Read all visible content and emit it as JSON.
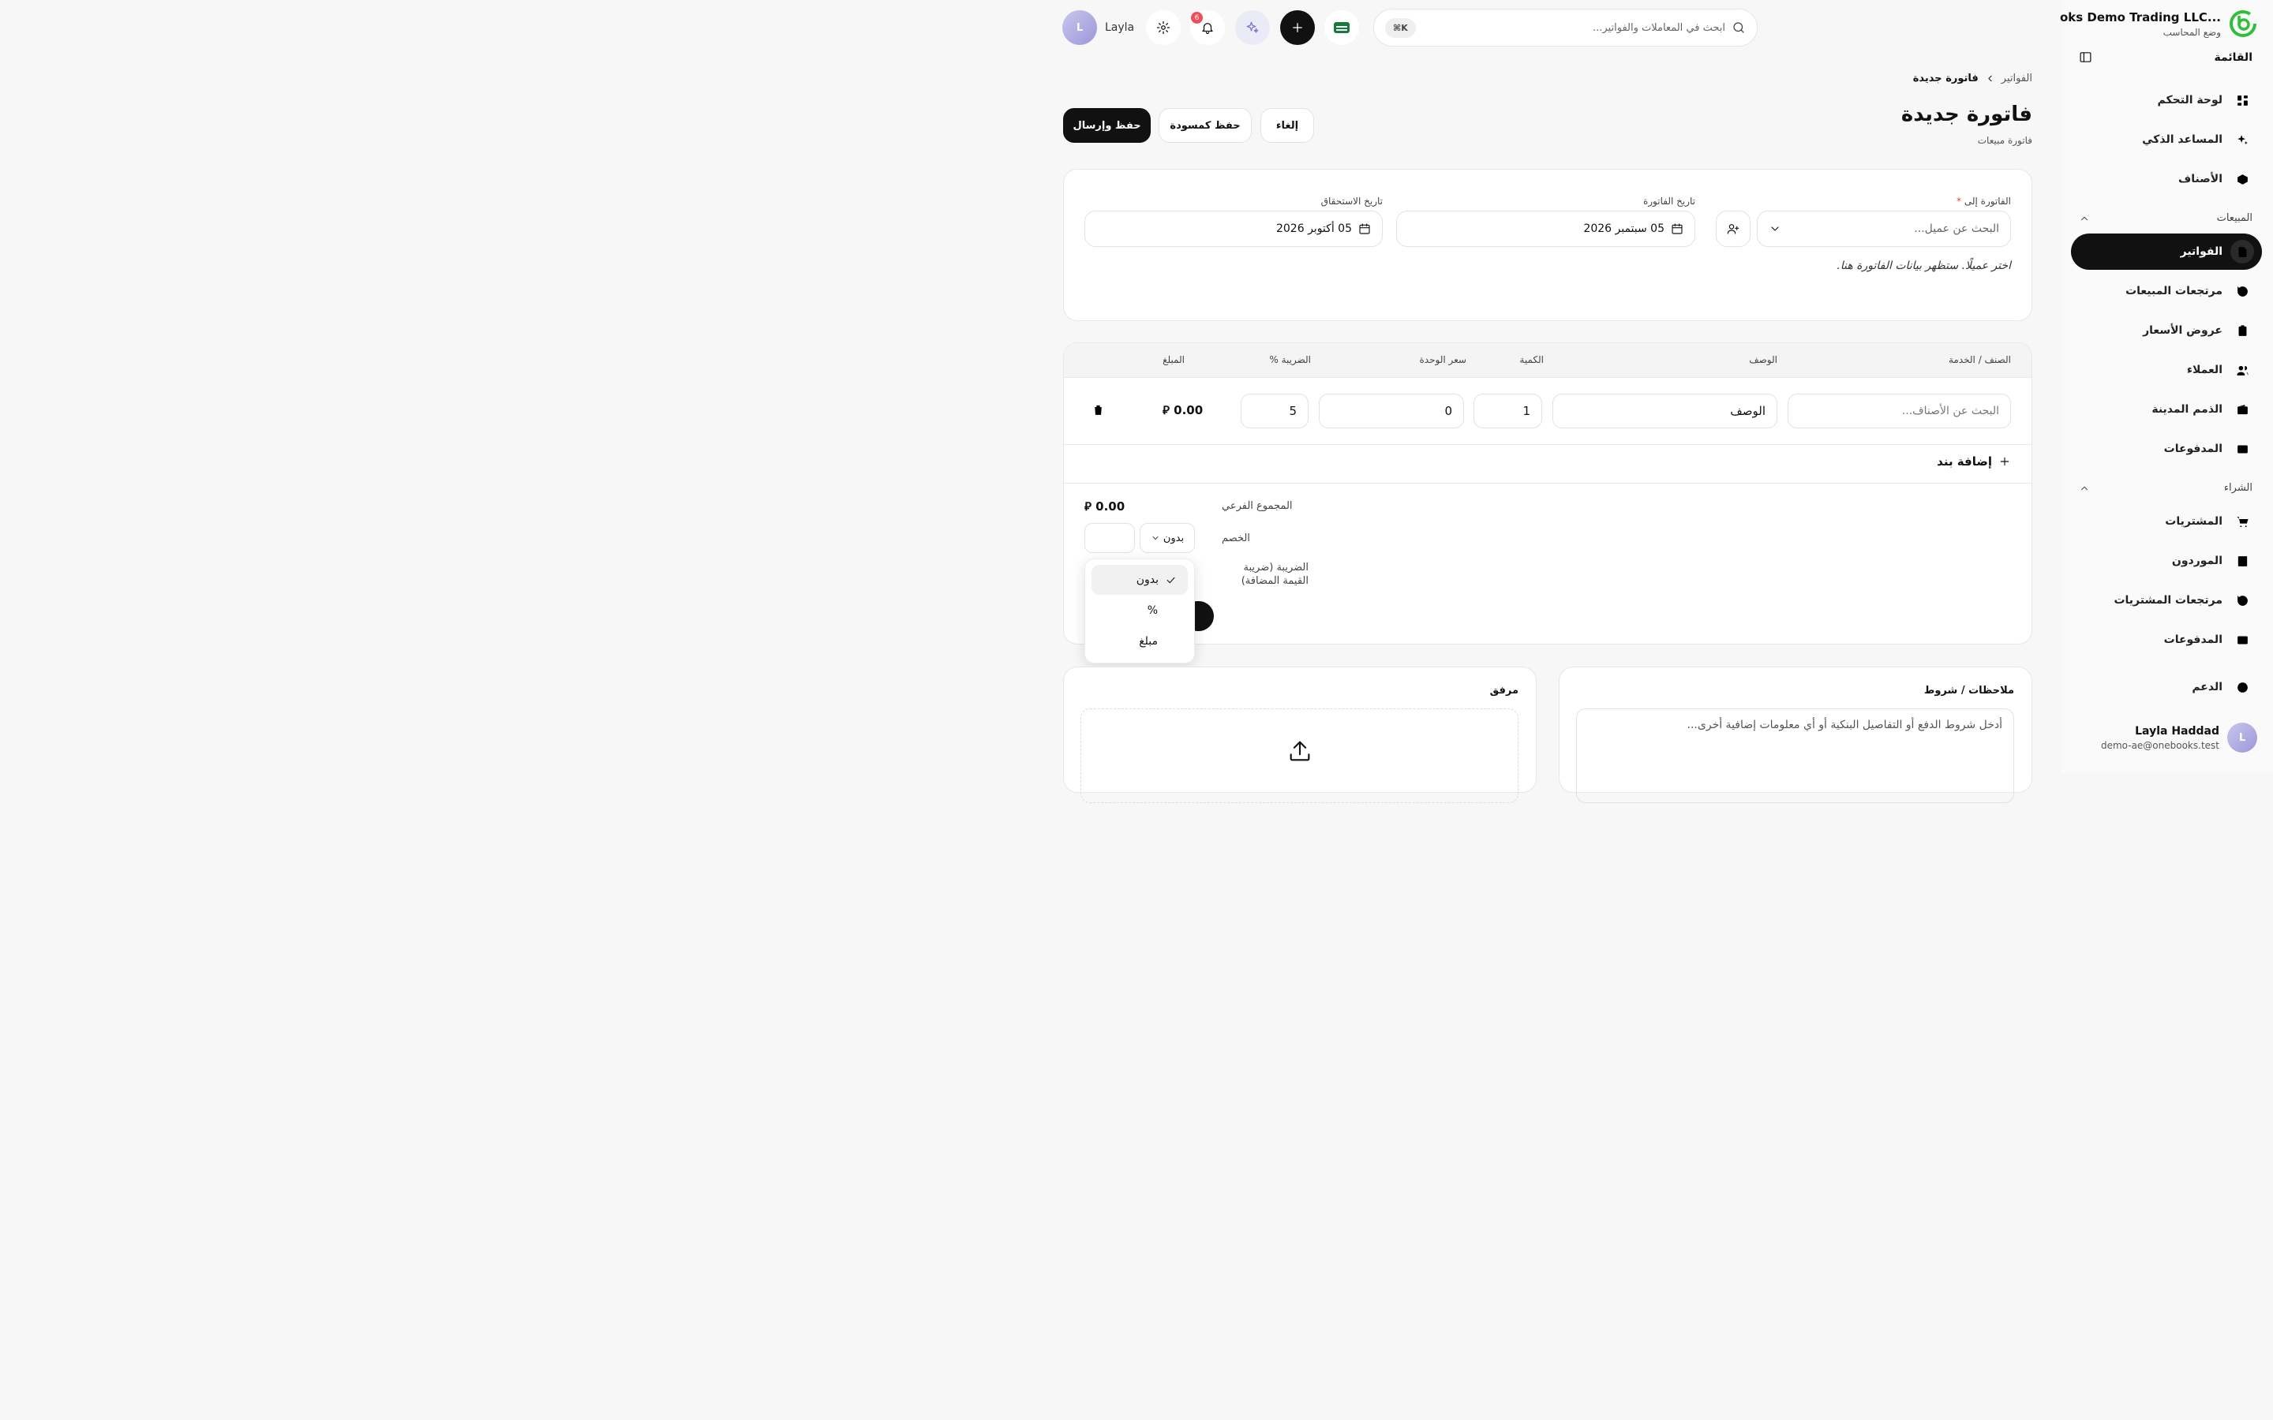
{
  "sidebar": {
    "brand_name": "oks Demo Trading LLC...",
    "brand_sub": "وضع المحاسب",
    "menu_title": "القائمة",
    "items_main": [
      {
        "label": "لوحة التحكم",
        "icon": "grid-icon"
      },
      {
        "label": "المساعد الذكي",
        "icon": "sparkles-icon"
      },
      {
        "label": "الأصناف",
        "icon": "box-icon"
      }
    ],
    "group_sales": "المبيعات",
    "items_sales": [
      {
        "label": "الفواتير",
        "icon": "file-text-icon"
      },
      {
        "label": "مرتجعات المبيعات",
        "icon": "rotate-ccw-icon"
      },
      {
        "label": "عروض الأسعار",
        "icon": "clipboard-icon"
      },
      {
        "label": "العملاء",
        "icon": "users-icon"
      },
      {
        "label": "الذمم المدينة",
        "icon": "wallet-icon"
      },
      {
        "label": "المدفوعات",
        "icon": "credit-card-icon"
      }
    ],
    "group_purchase": "الشراء",
    "items_purchase": [
      {
        "label": "المشتريات",
        "icon": "cart-icon"
      },
      {
        "label": "الموردون",
        "icon": "building-icon"
      },
      {
        "label": "مرتجعات المشتريات",
        "icon": "rotate-ccw-icon"
      },
      {
        "label": "المدفوعات",
        "icon": "credit-card-icon"
      }
    ],
    "support": "الدعم",
    "user_name": "Layla Haddad",
    "user_email": "demo-ae@onebooks.test",
    "user_initial": "L"
  },
  "topbar": {
    "search_placeholder": "ابحث في المعاملات والفواتير...",
    "search_shortcut": "⌘K",
    "notification_count": "6",
    "user_name": "Layla",
    "user_initial": "L"
  },
  "header": {
    "breadcrumb_parent": "الفواتير",
    "breadcrumb_current": "فاتورة جديدة",
    "title": "فاتورة جديدة",
    "subtitle": "فاتورة مبيعات",
    "save_send": "حفظ وإرسال",
    "save_draft": "حفظ كمسودة",
    "cancel": "إلغاء"
  },
  "form": {
    "bill_to_label": "الفاتورة إلى",
    "required_mark": "*",
    "customer_placeholder": "البحث عن عميل...",
    "invoice_date_label": "تاريخ الفاتورة",
    "invoice_date": "05 سبتمبر 2026",
    "due_date_label": "تاريخ الاستحقاق",
    "due_date": "05 أكتوبر 2026",
    "hint": "اختر عميلًا. ستظهر بيانات الفاتورة هنا."
  },
  "table": {
    "headers": {
      "item": "الصنف / الخدمة",
      "description": "الوصف",
      "quantity": "الكمية",
      "unit_price": "سعر الوحدة",
      "tax": "الضريبة %",
      "amount": "المبلغ"
    },
    "row": {
      "item_placeholder": "البحث عن الأصناف...",
      "description_placeholder": "الوصف",
      "quantity": "1",
      "unit_price": "0",
      "tax": "5",
      "amount": "0.00 ⃃"
    },
    "add_line": "إضافة بند"
  },
  "totals": {
    "subtotal_label": "المجموع الفرعي",
    "subtotal_value": "0.00 ⃃",
    "discount_label": "الخصم",
    "discount_type": "بدون",
    "tax_label": "الضريبة (ضريبة القيمة المضافة)"
  },
  "discount_dropdown": {
    "options": [
      "بدون",
      "%",
      "مبلغ"
    ],
    "selected": "بدون"
  },
  "notes": {
    "title": "ملاحظات / شروط",
    "placeholder": "أدخل شروط الدفع أو التفاصيل البنكية أو أي معلومات إضافية أخرى..."
  },
  "attachment": {
    "title": "مرفق"
  },
  "colors": {
    "primary": "#111111",
    "badge": "#ef4e5a",
    "logo": "#2fbf3a",
    "ai_accent": "#7d76c8"
  }
}
